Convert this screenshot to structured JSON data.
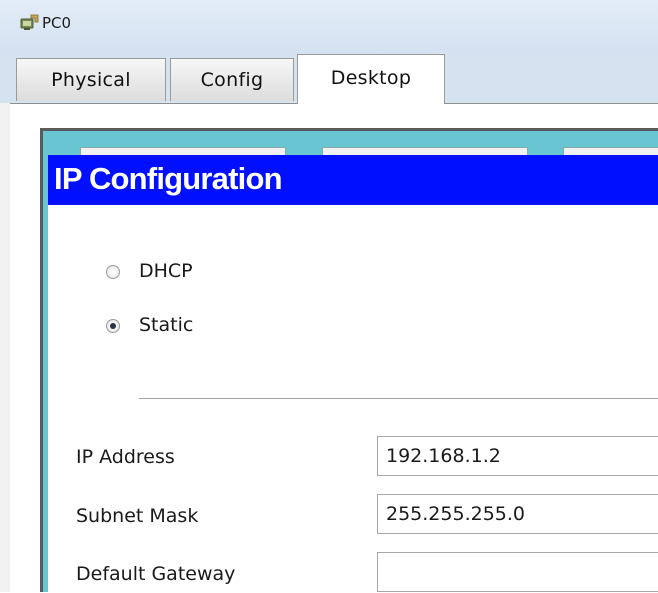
{
  "window": {
    "title": "PC0",
    "icon": "pc-device-icon"
  },
  "tabs": [
    {
      "label": "Physical",
      "active": false
    },
    {
      "label": "Config",
      "active": false
    },
    {
      "label": "Desktop",
      "active": true
    }
  ],
  "ip_config": {
    "title": "IP Configuration",
    "mode_options": [
      {
        "label": "DHCP",
        "selected": false
      },
      {
        "label": "Static",
        "selected": true
      }
    ],
    "fields": [
      {
        "label": "IP Address",
        "value": "192.168.1.2"
      },
      {
        "label": "Subnet Mask",
        "value": "255.255.255.0"
      },
      {
        "label": "Default Gateway",
        "value": ""
      }
    ]
  },
  "colors": {
    "dialog_title_bg": "#0010ff",
    "desktop_bg": "#68c5d2"
  }
}
